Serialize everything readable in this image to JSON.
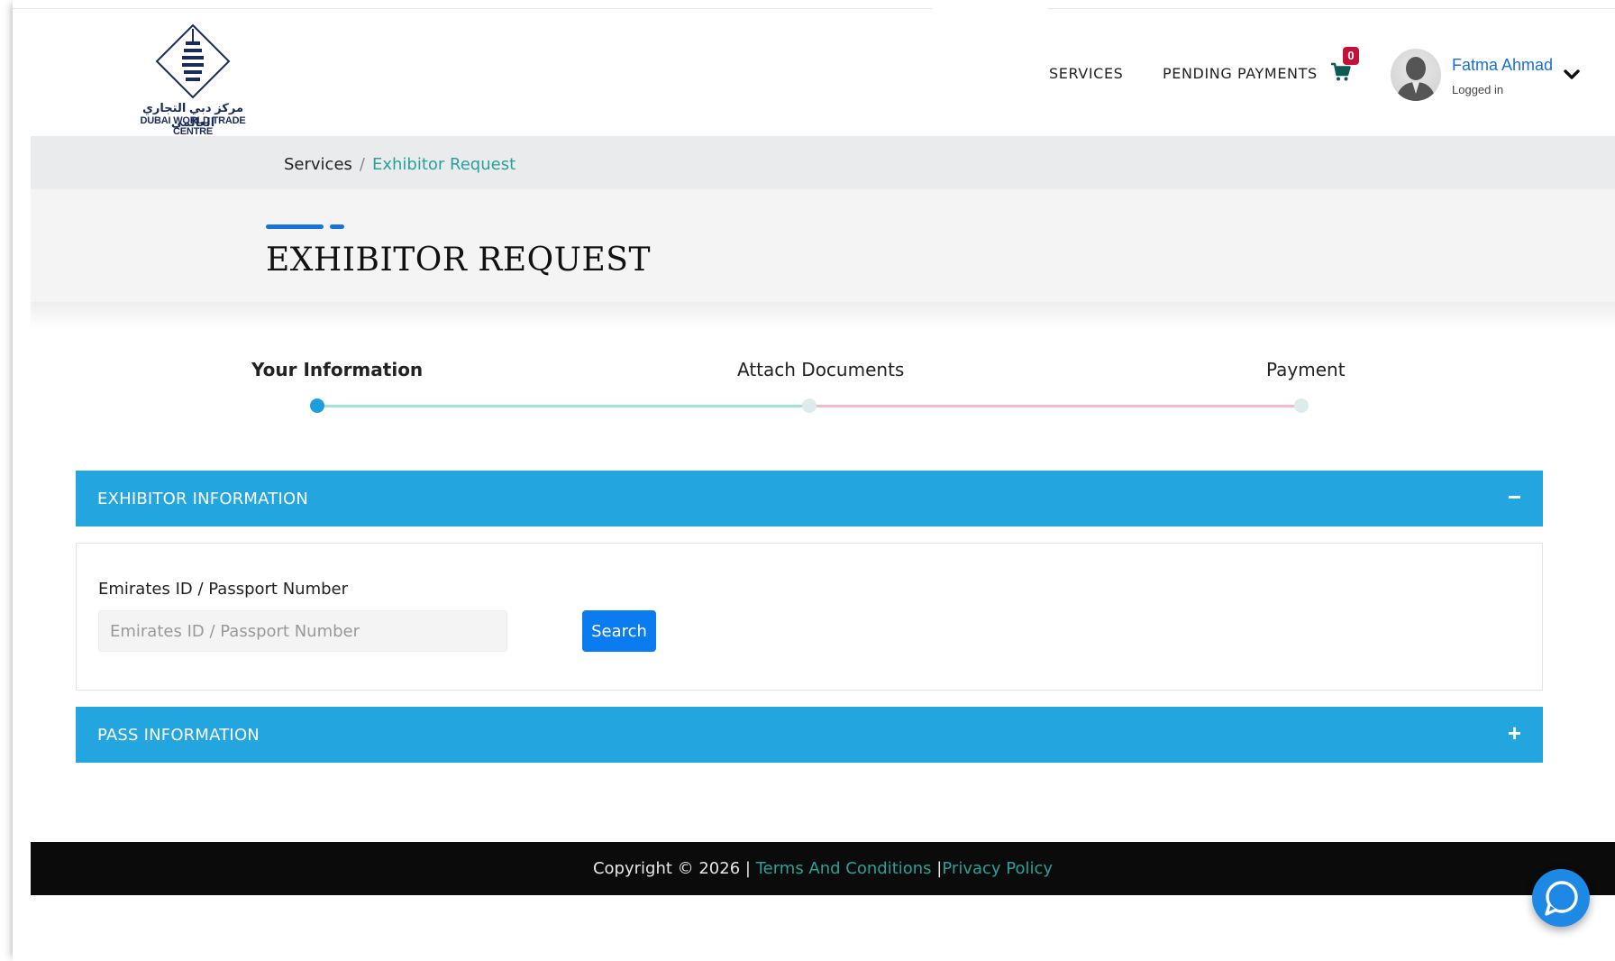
{
  "header": {
    "logo": {
      "arabic": "مركز دبي التجاري العالمي",
      "english": "DUBAI WORLD TRADE CENTRE"
    },
    "nav": {
      "services": "SERVICES",
      "pending_payments": "PENDING PAYMENTS"
    },
    "cart": {
      "icon": "cart-icon",
      "count": "0"
    },
    "user": {
      "name": "Fatma Ahmad",
      "status": "Logged in"
    }
  },
  "breadcrumb": {
    "items": [
      "Services",
      "Exhibitor Request"
    ],
    "separator": "/"
  },
  "page": {
    "title": "EXHIBITOR REQUEST"
  },
  "stepper": {
    "steps": [
      {
        "label": "Your Information",
        "state": "active"
      },
      {
        "label": "Attach Documents",
        "state": "pending"
      },
      {
        "label": "Payment",
        "state": "pending"
      }
    ]
  },
  "panels": [
    {
      "title": "EXHIBITOR INFORMATION",
      "toggle": "−",
      "expanded": true,
      "field_label": "Emirates ID / Passport Number",
      "field_placeholder": "Emirates ID / Passport Number",
      "field_value": "",
      "button": "Search"
    },
    {
      "title": "PASS INFORMATION",
      "toggle": "+",
      "expanded": false
    }
  ],
  "footer": {
    "copyright": "Copyright © 2026 |",
    "terms": "Terms And Conditions",
    "separator": "|",
    "privacy": "Privacy Policy"
  },
  "colors": {
    "accent": "#23a5df",
    "primary_button": "#0a7cf0",
    "link": "#2aa198",
    "badge": "#c4113a",
    "step_done_line": "#9fe3d9",
    "step_todo_line": "#f7b9cc"
  }
}
